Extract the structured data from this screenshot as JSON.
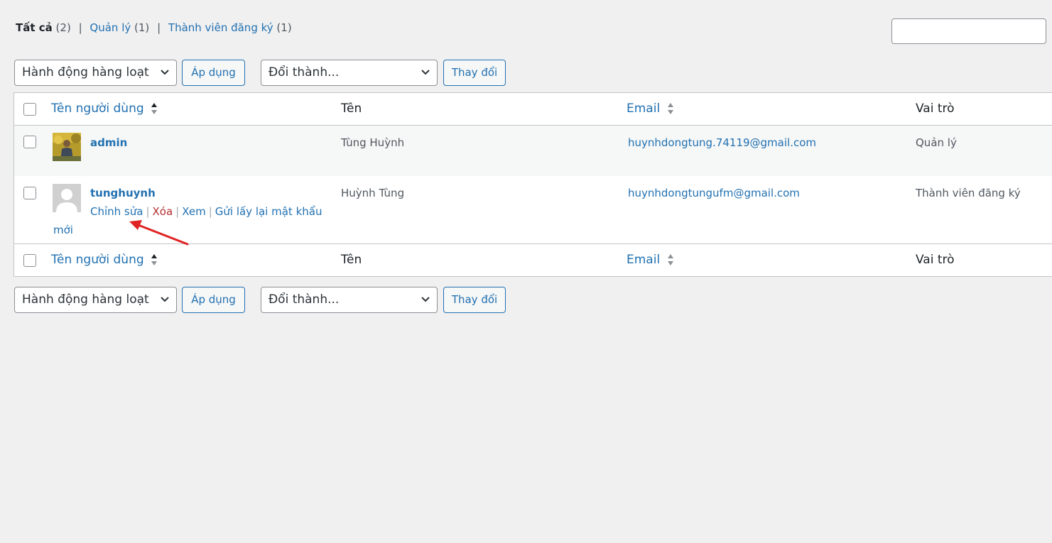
{
  "filters": {
    "all": {
      "label": "Tất cả",
      "count": "(2)"
    },
    "admin": {
      "label": "Quản lý",
      "count": "(1)"
    },
    "subscriber": {
      "label": "Thành viên đăng ký",
      "count": "(1)"
    },
    "separator": "|"
  },
  "search": {
    "value": ""
  },
  "bulk": {
    "action_label": "Hành động hàng loạt",
    "apply_label": "Áp dụng",
    "role_label": "Đổi thành...",
    "change_label": "Thay đổi"
  },
  "table": {
    "columns": {
      "username": "Tên người dùng",
      "name": "Tên",
      "email": "Email",
      "role": "Vai trò"
    },
    "rows": [
      {
        "username": "admin",
        "name": "Tùng Huỳnh",
        "email": "huynhdongtung.74119@gmail.com",
        "role": "Quản lý"
      },
      {
        "username": "tunghuynh",
        "name": "Huỳnh Tùng",
        "email": "huynhdongtungufm@gmail.com",
        "role": "Thành viên đăng ký"
      }
    ],
    "row_actions": {
      "edit": "Chỉnh sửa",
      "delete": "Xóa",
      "view": "Xem",
      "reset_password_part1": "Gửi lấy lại mật khẩu",
      "reset_password_part2": "mới",
      "separator": "|"
    }
  },
  "colors": {
    "link": "#2271b1",
    "delete": "#b32d2e",
    "arrow": "#e02424"
  },
  "icons": {
    "sort": "sort-arrows-icon",
    "chevron": "chevron-down-icon",
    "annotation": "red-arrow-annotation"
  }
}
